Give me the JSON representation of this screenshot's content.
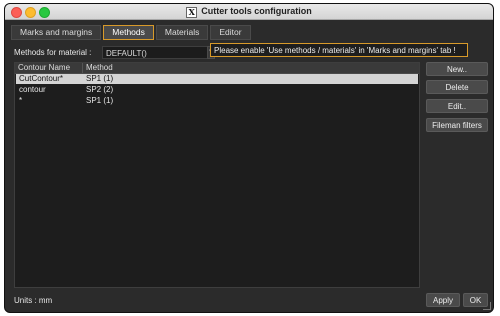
{
  "window": {
    "title": "Cutter tools configuration"
  },
  "tabs": [
    {
      "label": "Marks and margins",
      "active": false
    },
    {
      "label": "Methods",
      "active": true
    },
    {
      "label": "Materials",
      "active": false
    },
    {
      "label": "Editor",
      "active": false
    }
  ],
  "material": {
    "label": "Methods for material  :",
    "value": "DEFAULT()"
  },
  "warning": "Please enable 'Use methods / materials' in 'Marks and margins' tab !",
  "table": {
    "columns": [
      "Contour Name",
      "Method"
    ],
    "rows": [
      {
        "name": "CutContour*",
        "method": "SP1 (1)",
        "selected": true
      },
      {
        "name": "contour",
        "method": "SP2 (2)",
        "selected": false
      },
      {
        "name": "*",
        "method": "SP1 (1)",
        "selected": false
      }
    ]
  },
  "side_buttons": {
    "new": "New..",
    "delete": "Delete",
    "edit": "Edit..",
    "fileman": "Fileman filters"
  },
  "footer": {
    "units": "Units : mm",
    "apply": "Apply",
    "ok": "OK"
  },
  "colors": {
    "accent": "#d89a2a",
    "window_bg": "#2b2b2b",
    "selection": "#d4d4d4"
  }
}
